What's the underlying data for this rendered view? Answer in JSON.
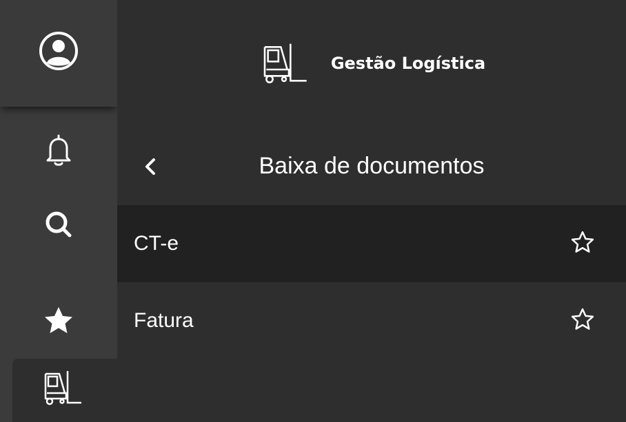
{
  "app": {
    "title": "Gestão Logística"
  },
  "rail": {
    "items": [
      {
        "icon": "user-circle-icon"
      },
      {
        "icon": "bell-icon"
      },
      {
        "icon": "search-icon"
      },
      {
        "icon": "star-filled-icon"
      },
      {
        "icon": "forklift-icon",
        "active": true
      }
    ]
  },
  "section": {
    "title": "Baixa de documentos",
    "back_icon": "chevron-left-icon"
  },
  "menu": {
    "items": [
      {
        "label": "CT-e",
        "favorite": false,
        "selected": true
      },
      {
        "label": "Fatura",
        "favorite": false,
        "selected": false
      }
    ]
  },
  "colors": {
    "rail_bg": "#3b3b3b",
    "panel_bg": "#2e2e2e",
    "selected_row_bg": "#212121",
    "text": "#ffffff"
  }
}
